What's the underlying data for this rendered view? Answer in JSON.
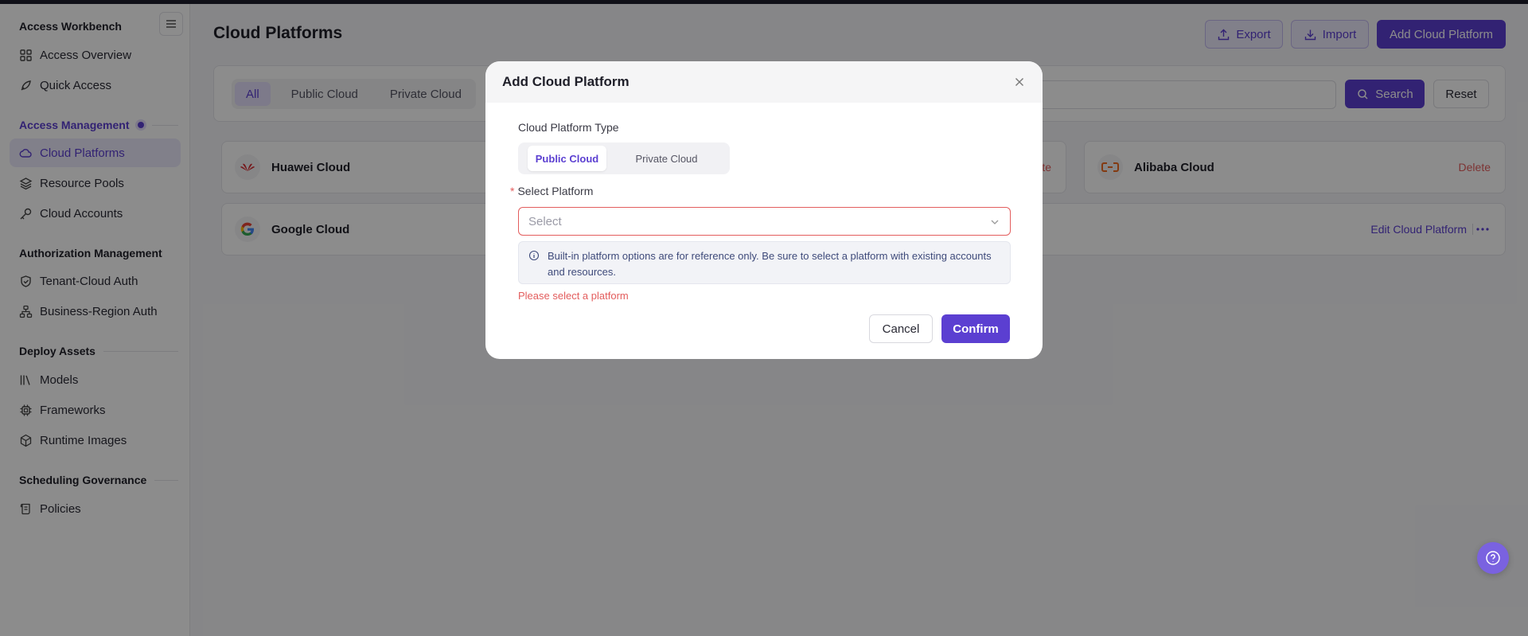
{
  "sidebar": {
    "groups": [
      {
        "title": "Access Workbench",
        "items": [
          {
            "label": "Access Overview",
            "icon": "grid-icon"
          },
          {
            "label": "Quick Access",
            "icon": "rocket-icon"
          }
        ]
      },
      {
        "title": "Access Management",
        "items": [
          {
            "label": "Cloud Platforms",
            "icon": "cloud-icon"
          },
          {
            "label": "Resource Pools",
            "icon": "layers-icon"
          },
          {
            "label": "Cloud Accounts",
            "icon": "key-icon"
          }
        ]
      },
      {
        "title": "Authorization Management",
        "items": [
          {
            "label": "Tenant-Cloud Auth",
            "icon": "shield-icon"
          },
          {
            "label": "Business-Region Auth",
            "icon": "hierarchy-icon"
          }
        ]
      },
      {
        "title": "Deploy Assets",
        "items": [
          {
            "label": "Models",
            "icon": "library-icon"
          },
          {
            "label": "Frameworks",
            "icon": "chip-icon"
          },
          {
            "label": "Runtime Images",
            "icon": "package-icon"
          }
        ]
      },
      {
        "title": "Scheduling Governance",
        "items": [
          {
            "label": "Policies",
            "icon": "scroll-icon"
          }
        ]
      }
    ],
    "active_item": "Cloud Platforms"
  },
  "header": {
    "title": "Cloud Platforms",
    "export_label": "Export",
    "import_label": "Import",
    "add_label": "Add Cloud Platform"
  },
  "filters": {
    "tabs": [
      "All",
      "Public Cloud",
      "Private Cloud"
    ],
    "active_tab": "All",
    "search_label": "Search",
    "reset_label": "Reset"
  },
  "cards": [
    {
      "name": "Huawei Cloud",
      "action": "Delete"
    },
    {
      "name": "Alibaba Cloud",
      "action": "Delete"
    },
    {
      "name": "Google Cloud",
      "action": "Edit Cloud Platform"
    }
  ],
  "modal": {
    "title": "Add Cloud Platform",
    "type_label": "Cloud Platform Type",
    "type_options": [
      "Public Cloud",
      "Private Cloud"
    ],
    "type_selected": "Public Cloud",
    "platform_label": "Select Platform",
    "required_mark": "*",
    "platform_placeholder": "Select",
    "notice": "Built-in platform options are for reference only. Be sure to select a platform with existing accounts and resources.",
    "error": "Please select a platform",
    "cancel_label": "Cancel",
    "confirm_label": "Confirm"
  },
  "colors": {
    "accent": "#5b3fd1",
    "danger": "#e35d5d",
    "overlay": "rgba(0,0,0,0.45)"
  }
}
